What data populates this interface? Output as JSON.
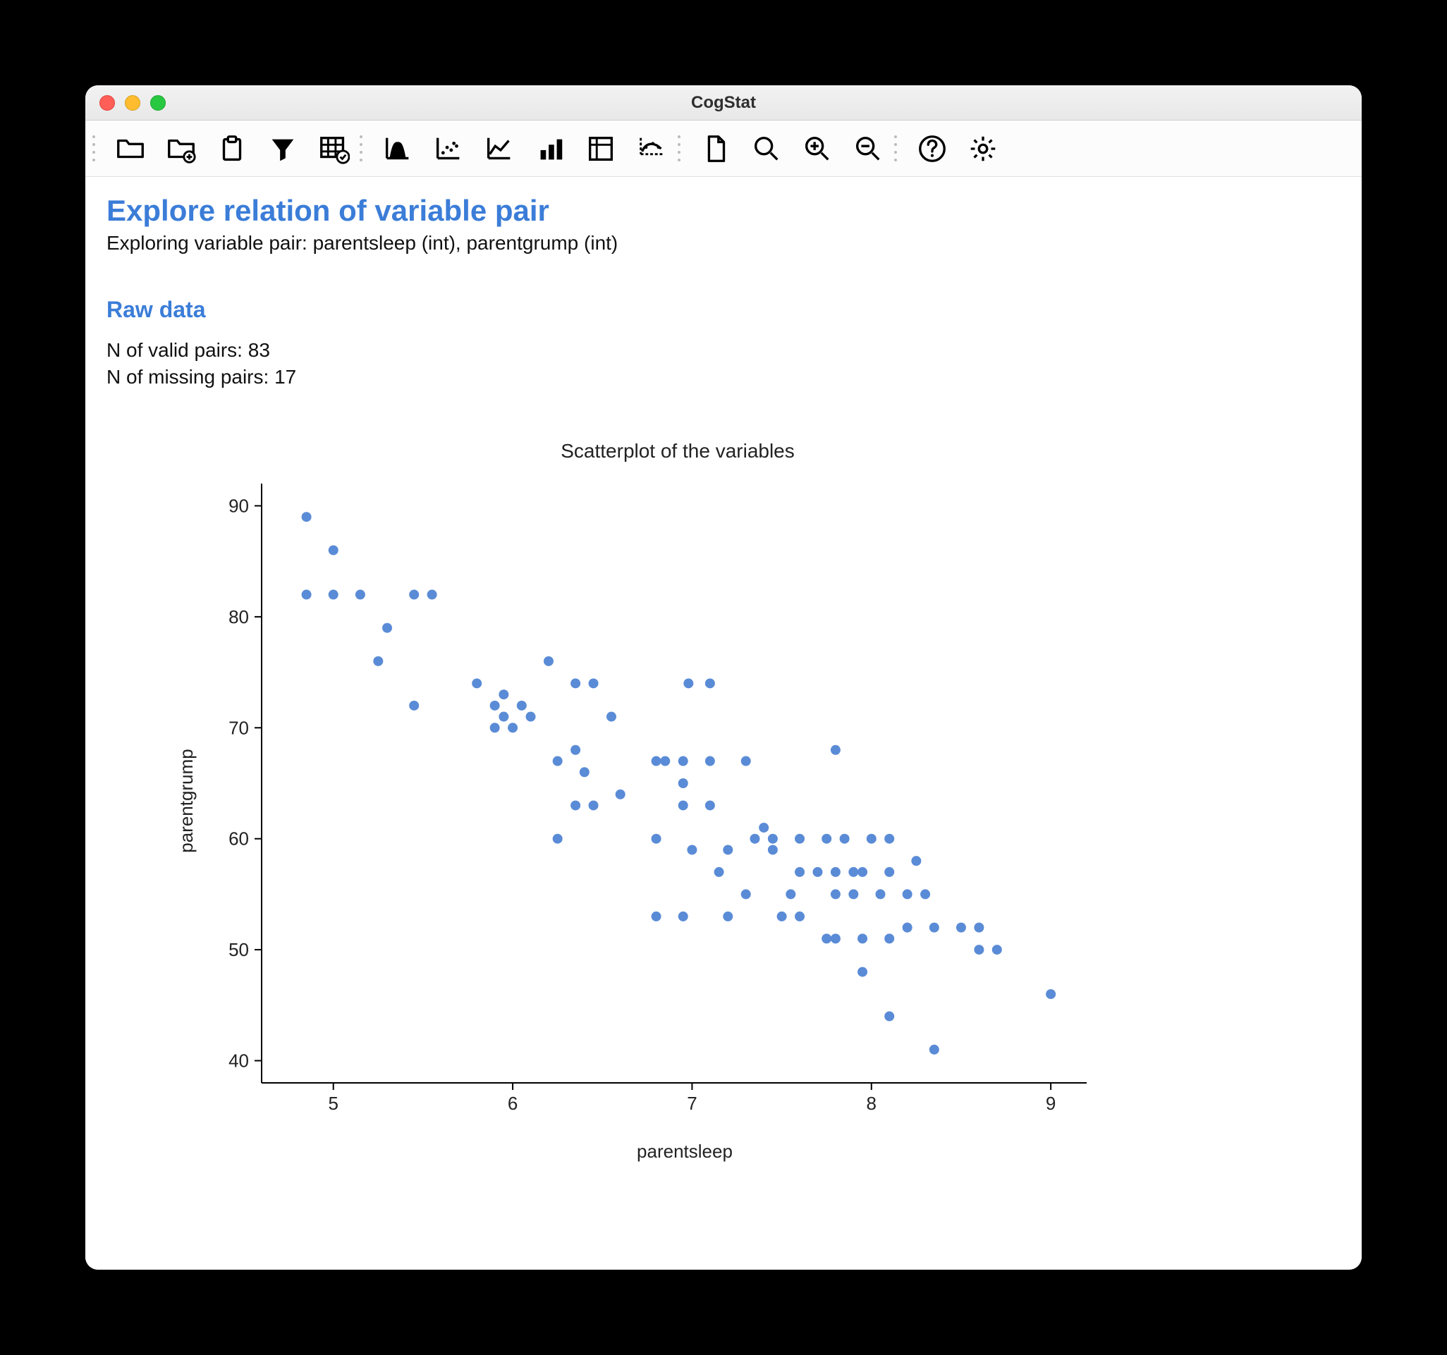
{
  "window": {
    "title": "CogStat"
  },
  "toolbar": {
    "items": [
      "open-folder-icon",
      "open-folder-plus-icon",
      "clipboard-icon",
      "filter-icon",
      "data-grid-check-icon",
      "distribution-icon",
      "scatter-icon",
      "line-chart-icon",
      "bar-chart-icon",
      "pivot-table-icon",
      "regression-icon",
      "new-doc-icon",
      "search-icon",
      "zoom-in-icon",
      "zoom-out-icon",
      "help-icon",
      "settings-icon"
    ]
  },
  "report": {
    "title": "Explore relation of variable pair",
    "subtitle": "Exploring variable pair: parentsleep (int), parentgrump (int)",
    "raw_heading": "Raw data",
    "valid_label": "N of valid pairs: 83",
    "missing_label": "N of missing pairs: 17"
  },
  "chart_data": {
    "type": "scatter",
    "title": "Scatterplot of the variables",
    "xlabel": "parentsleep",
    "ylabel": "parentgrump",
    "xlim": [
      4.6,
      9.2
    ],
    "ylim": [
      38,
      92
    ],
    "xticks": [
      5,
      6,
      7,
      8,
      9
    ],
    "yticks": [
      40,
      50,
      60,
      70,
      80,
      90
    ],
    "points": [
      [
        4.85,
        89
      ],
      [
        5.0,
        86
      ],
      [
        4.85,
        82
      ],
      [
        5.0,
        82
      ],
      [
        5.15,
        82
      ],
      [
        5.45,
        82
      ],
      [
        5.55,
        82
      ],
      [
        5.3,
        79
      ],
      [
        5.25,
        76
      ],
      [
        5.45,
        72
      ],
      [
        6.2,
        76
      ],
      [
        6.35,
        74
      ],
      [
        6.45,
        74
      ],
      [
        6.98,
        74
      ],
      [
        7.1,
        74
      ],
      [
        5.8,
        74
      ],
      [
        5.95,
        73
      ],
      [
        5.9,
        72
      ],
      [
        6.05,
        72
      ],
      [
        5.95,
        71
      ],
      [
        6.1,
        71
      ],
      [
        5.9,
        70
      ],
      [
        6.0,
        70
      ],
      [
        6.55,
        71
      ],
      [
        6.35,
        68
      ],
      [
        6.25,
        67
      ],
      [
        6.4,
        66
      ],
      [
        6.35,
        63
      ],
      [
        6.45,
        63
      ],
      [
        6.6,
        64
      ],
      [
        6.25,
        60
      ],
      [
        6.8,
        67
      ],
      [
        6.85,
        67
      ],
      [
        6.95,
        67
      ],
      [
        7.1,
        67
      ],
      [
        7.3,
        67
      ],
      [
        6.95,
        65
      ],
      [
        6.95,
        63
      ],
      [
        7.1,
        63
      ],
      [
        6.8,
        60
      ],
      [
        7.0,
        59
      ],
      [
        7.2,
        59
      ],
      [
        7.45,
        59
      ],
      [
        7.4,
        61
      ],
      [
        7.35,
        60
      ],
      [
        7.45,
        60
      ],
      [
        7.6,
        60
      ],
      [
        7.15,
        57
      ],
      [
        7.3,
        55
      ],
      [
        7.55,
        55
      ],
      [
        7.75,
        60
      ],
      [
        7.85,
        60
      ],
      [
        8.0,
        60
      ],
      [
        8.1,
        60
      ],
      [
        7.6,
        57
      ],
      [
        7.7,
        57
      ],
      [
        7.8,
        57
      ],
      [
        7.9,
        57
      ],
      [
        7.95,
        57
      ],
      [
        8.1,
        57
      ],
      [
        8.25,
        58
      ],
      [
        7.8,
        55
      ],
      [
        7.9,
        55
      ],
      [
        8.05,
        55
      ],
      [
        8.2,
        55
      ],
      [
        8.3,
        55
      ],
      [
        6.8,
        53
      ],
      [
        6.95,
        53
      ],
      [
        7.2,
        53
      ],
      [
        7.5,
        53
      ],
      [
        7.6,
        53
      ],
      [
        7.75,
        51
      ],
      [
        7.8,
        51
      ],
      [
        7.95,
        51
      ],
      [
        8.1,
        51
      ],
      [
        8.2,
        52
      ],
      [
        8.35,
        52
      ],
      [
        8.5,
        52
      ],
      [
        8.6,
        52
      ],
      [
        7.95,
        48
      ],
      [
        8.6,
        50
      ],
      [
        8.7,
        50
      ],
      [
        8.1,
        44
      ],
      [
        9.0,
        46
      ],
      [
        8.35,
        41
      ],
      [
        7.8,
        68
      ]
    ]
  }
}
